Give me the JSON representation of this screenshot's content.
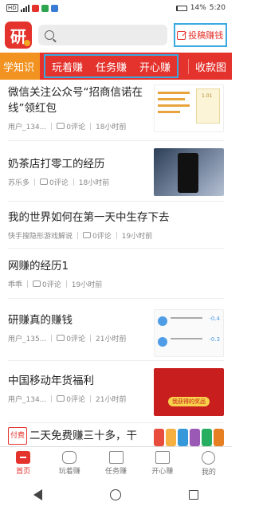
{
  "status": {
    "battery": "14%",
    "time": "5:20"
  },
  "header": {
    "submit_label": "投稿赚钱"
  },
  "tabs": {
    "left": "学知识",
    "center": [
      "玩着赚",
      "任务赚",
      "开心赚"
    ],
    "right": "收款图"
  },
  "feed": [
    {
      "title": "微信关注公众号“招商信诺在线”领红包",
      "author": "用户_134...",
      "comments": "0评论",
      "time": "18小时前",
      "thumb_value": "1.01"
    },
    {
      "title": "奶茶店打零工的经历",
      "author": "苏乐多",
      "comments": "0评论",
      "time": "18小时前"
    },
    {
      "title": "我的世界如何在第一天中生存下去",
      "author": "快手搜隐形游戏解说",
      "comments": "0评论",
      "time": "19小时前"
    },
    {
      "title": "网赚的经历1",
      "author": "乖乖",
      "comments": "0评论",
      "time": "19小时前"
    },
    {
      "title": "研赚真的赚钱",
      "author": "用户_135...",
      "comments": "0评论",
      "time": "21小时前",
      "thumb_amounts": [
        "-0.4",
        "-0.3"
      ]
    },
    {
      "title": "中国移动年货福利",
      "author": "用户_134...",
      "comments": "0评论",
      "time": "21小时前",
      "thumb_label": "我获得的奖品"
    },
    {
      "badge": "付费",
      "title": "二天免费赚三十多，干他"
    }
  ],
  "bottom_nav": [
    {
      "label": "首页",
      "icon": "home-icon",
      "active": true
    },
    {
      "label": "玩着赚",
      "icon": "gamepad-icon"
    },
    {
      "label": "任务赚",
      "icon": "task-icon"
    },
    {
      "label": "开心赚",
      "icon": "star-icon"
    },
    {
      "label": "我的",
      "icon": "smile-icon"
    }
  ],
  "colors": {
    "brand": "#e4322c",
    "orange": "#f29321",
    "highlight": "#39a9e0"
  }
}
